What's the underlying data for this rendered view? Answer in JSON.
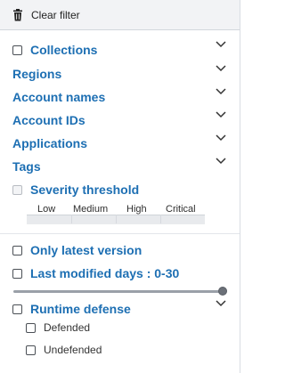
{
  "toolbar": {
    "clear_filter_label": "Clear filter",
    "icon": "trash-icon"
  },
  "filters": {
    "collections": "Collections",
    "regions": "Regions",
    "account_names": "Account names",
    "account_ids": "Account IDs",
    "applications": "Applications",
    "tags": "Tags",
    "severity_threshold": "Severity threshold",
    "severity_levels": [
      "Low",
      "Medium",
      "High",
      "Critical"
    ],
    "only_latest_version": "Only latest version",
    "last_modified": "Last modified days : 0-30",
    "last_modified_range": [
      0,
      30
    ],
    "runtime_defense": "Runtime defense",
    "runtime_options": [
      "Defended",
      "Undefended"
    ]
  },
  "colors": {
    "accent": "#1d6fb3",
    "header_bg": "#f2f3f5"
  }
}
